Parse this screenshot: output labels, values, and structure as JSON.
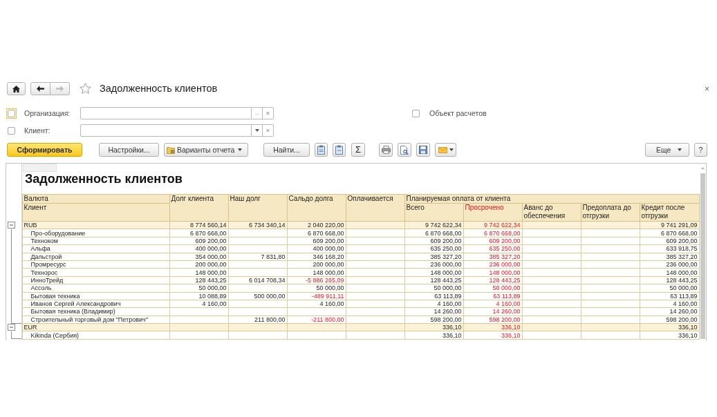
{
  "window": {
    "title": "Задолженность клиентов",
    "favorite": false,
    "close": "×"
  },
  "navigation": {
    "back_disabled": false,
    "forward_disabled": true
  },
  "filters": [
    {
      "label": "Организация:",
      "checked": false,
      "focused": true,
      "kind": "choice",
      "choose": "...",
      "clear": "×"
    },
    {
      "label": "Клиент:",
      "checked": false,
      "kind": "dropdown",
      "clear": "×"
    }
  ],
  "option": {
    "label": "Объект расчетов",
    "checked": false
  },
  "toolbar": {
    "generate": "Сформировать",
    "settings": "Настройки...",
    "variants": "Варианты отчета",
    "find": "Найти...",
    "sum": "Σ",
    "more": "Еще",
    "help": "?"
  },
  "report": {
    "title": "Задолженность клиентов",
    "header": {
      "currency": "Валюта",
      "client": "Клиент",
      "columns": [
        {
          "label": "Долг клиента"
        },
        {
          "label": "Наш долг"
        },
        {
          "label": "Сальдо долга"
        },
        {
          "label": "Оплачивается"
        }
      ],
      "planned": {
        "label": "Планируемая оплата от клиента",
        "columns": [
          {
            "label": "Всего",
            "alert": false
          },
          {
            "label": "Просрочено",
            "alert": true
          },
          {
            "label": "Аванс до обеспечения",
            "alert": false
          },
          {
            "label": "Предоплата до отгрузки",
            "alert": false
          },
          {
            "label": "Кредит после отгрузки",
            "alert": false
          }
        ]
      }
    },
    "groups": [
      {
        "currency": "RUB",
        "expanded": true,
        "cells": {
          "client_debt": "8 774 560,14",
          "our_debt": "6 734 340,14",
          "balance": "2 040 220,00",
          "total": "9 742 622,34",
          "overdue": "9 742 622,34",
          "credit": "9 741 291,09"
        },
        "clients": [
          {
            "name": "Про-оборудование",
            "cells": {
              "client_debt": "6 870 668,00",
              "balance": "6 870 668,00",
              "total": "6 870 668,00",
              "overdue": "6 870 668,00",
              "credit": "6 870 668,00"
            }
          },
          {
            "name": "Техноком",
            "cells": {
              "client_debt": "609 200,00",
              "balance": "609 200,00",
              "total": "609 200,00",
              "overdue": "609 200,00",
              "credit": "609 200,00"
            }
          },
          {
            "name": "Альфа",
            "cells": {
              "client_debt": "400 000,00",
              "balance": "400 000,00",
              "total": "635 250,00",
              "overdue": "635 250,00",
              "credit": "633 918,75"
            }
          },
          {
            "name": "Дальстрой",
            "cells": {
              "client_debt": "354 000,00",
              "our_debt": "7 831,80",
              "balance": "346 168,20",
              "total": "385 327,20",
              "overdue": "385 327,20",
              "credit": "385 327,20"
            }
          },
          {
            "name": "Промресурс",
            "cells": {
              "client_debt": "200 000,00",
              "balance": "200 000,00",
              "total": "236 000,00",
              "overdue": "236 000,00",
              "credit": "236 000,00"
            }
          },
          {
            "name": "Технорос",
            "cells": {
              "client_debt": "148 000,00",
              "balance": "148 000,00",
              "total": "148 000,00",
              "overdue": "148 000,00",
              "credit": "148 000,00"
            }
          },
          {
            "name": "ИнноТрейд",
            "balance_negative": true,
            "cells": {
              "client_debt": "128 443,25",
              "our_debt": "6 014 708,34",
              "balance": "-5 886 265,09",
              "total": "128 443,25",
              "overdue": "128 443,25",
              "credit": "128 443,25"
            }
          },
          {
            "name": "Ассоль",
            "cells": {
              "client_debt": "50 000,00",
              "balance": "50 000,00",
              "total": "50 000,00",
              "overdue": "50 000,00",
              "credit": "50 000,00"
            }
          },
          {
            "name": "Бытовая техника",
            "balance_negative": true,
            "cells": {
              "client_debt": "10 088,89",
              "our_debt": "500 000,00",
              "balance": "-489 911,11",
              "total": "63 113,89",
              "overdue": "63 113,89",
              "credit": "63 113,89"
            }
          },
          {
            "name": "Иванов Сергей Александрович",
            "cells": {
              "client_debt": "4 160,00",
              "balance": "4 160,00",
              "total": "4 160,00",
              "overdue": "4 160,00",
              "credit": "4 160,00"
            }
          },
          {
            "name": "Бытовая техника (Владимир)",
            "cells": {
              "total": "14 260,00",
              "overdue": "14 260,00",
              "credit": "14 260,00"
            }
          },
          {
            "name": "Строительный торговый дом \"Петрович\"",
            "balance_negative": true,
            "cells": {
              "our_debt": "211 800,00",
              "balance": "-211 800,00",
              "total": "598 200,00",
              "overdue": "598 200,00",
              "credit": "598 200,00"
            }
          }
        ]
      },
      {
        "currency": "EUR",
        "expanded": true,
        "cells": {
          "total": "336,10",
          "overdue": "336,10",
          "credit": "336,10"
        },
        "clients": [
          {
            "name": "Kikinda (Сербия)",
            "cells": {
              "total": "336,10",
              "overdue": "336,10",
              "credit": "336,10"
            }
          }
        ]
      }
    ]
  }
}
